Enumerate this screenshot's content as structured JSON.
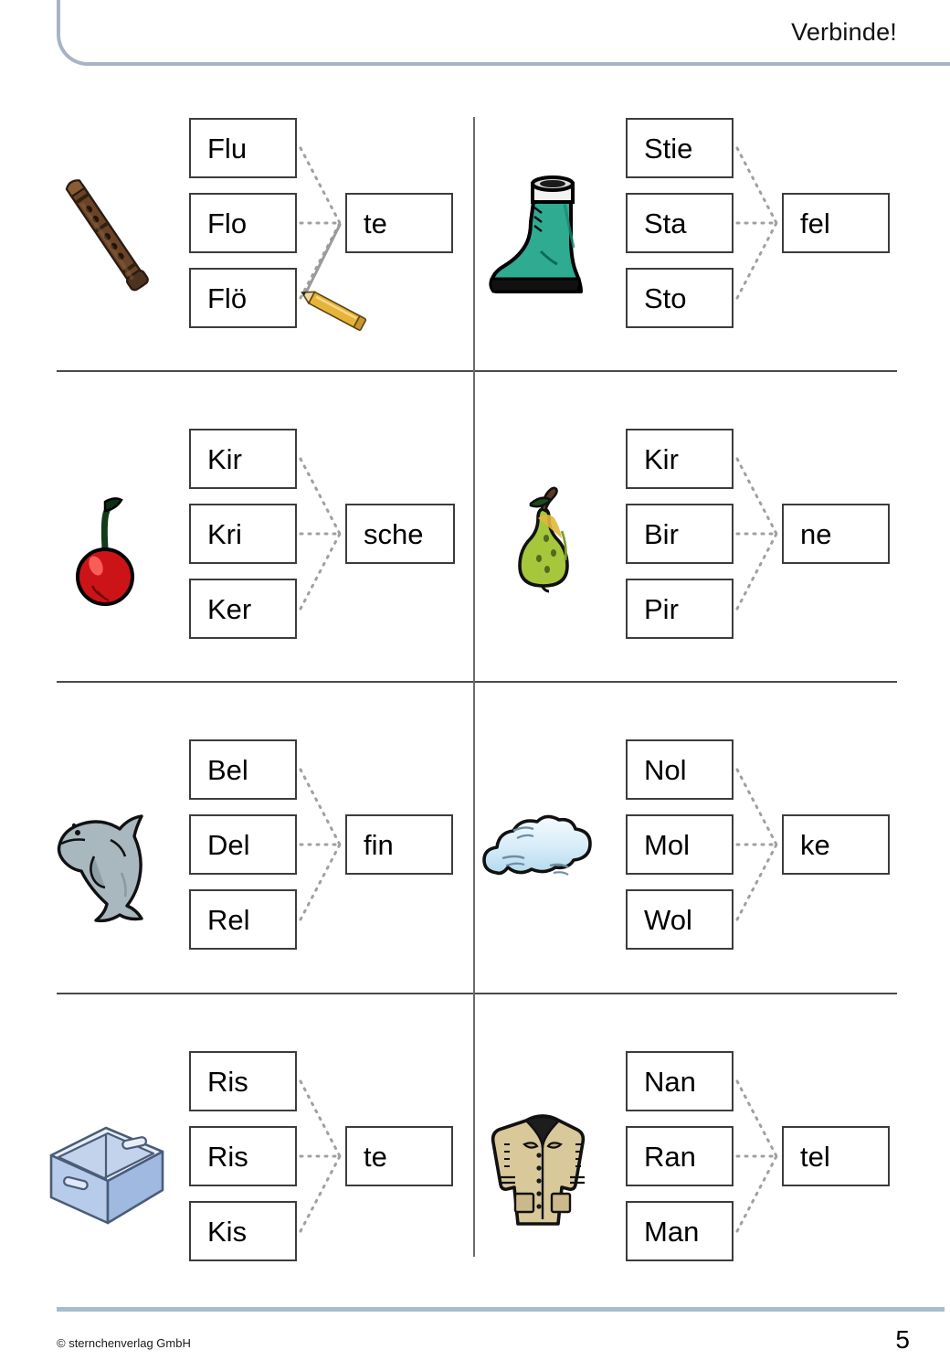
{
  "header": {
    "title": "Verbinde!"
  },
  "footer": {
    "copyright": "© sternchenverlag GmbH",
    "page_number": "5"
  },
  "colors": {
    "header_border": "#a8b3c4",
    "divider": "#4a4a4a",
    "box_border": "#3c3c3c",
    "footer_rule": "#a8bccd",
    "connector_dotted": "#a0a0a0",
    "pencil_body": "#e8b33a",
    "drawn_line": "#9a9a9a"
  },
  "exercises": [
    {
      "picture": "recorder-flute-icon",
      "picture_label": "Flöte",
      "syllables": [
        "Flu",
        "Flo",
        "Flö"
      ],
      "ending": "te",
      "has_pencil": true
    },
    {
      "picture": "rubber-boot-icon",
      "picture_label": "Stiefel",
      "syllables": [
        "Stie",
        "Sta",
        "Sto"
      ],
      "ending": "fel",
      "has_pencil": false
    },
    {
      "picture": "cherry-icon",
      "picture_label": "Kirsche",
      "syllables": [
        "Kir",
        "Kri",
        "Ker"
      ],
      "ending": "sche",
      "has_pencil": false
    },
    {
      "picture": "pear-icon",
      "picture_label": "Birne",
      "syllables": [
        "Kir",
        "Bir",
        "Pir"
      ],
      "ending": "ne",
      "has_pencil": false
    },
    {
      "picture": "dolphin-icon",
      "picture_label": "Delfin",
      "syllables": [
        "Bel",
        "Del",
        "Rel"
      ],
      "ending": "fin",
      "has_pencil": false
    },
    {
      "picture": "cloud-icon",
      "picture_label": "Wolke",
      "syllables": [
        "Nol",
        "Mol",
        "Wol"
      ],
      "ending": "ke",
      "has_pencil": false
    },
    {
      "picture": "storage-crate-icon",
      "picture_label": "Kiste",
      "syllables": [
        "Ris",
        "Ris",
        "Kis"
      ],
      "ending": "te",
      "has_pencil": false
    },
    {
      "picture": "coat-icon",
      "picture_label": "Mantel",
      "syllables": [
        "Nan",
        "Ran",
        "Man"
      ],
      "ending": "tel",
      "has_pencil": false
    }
  ]
}
